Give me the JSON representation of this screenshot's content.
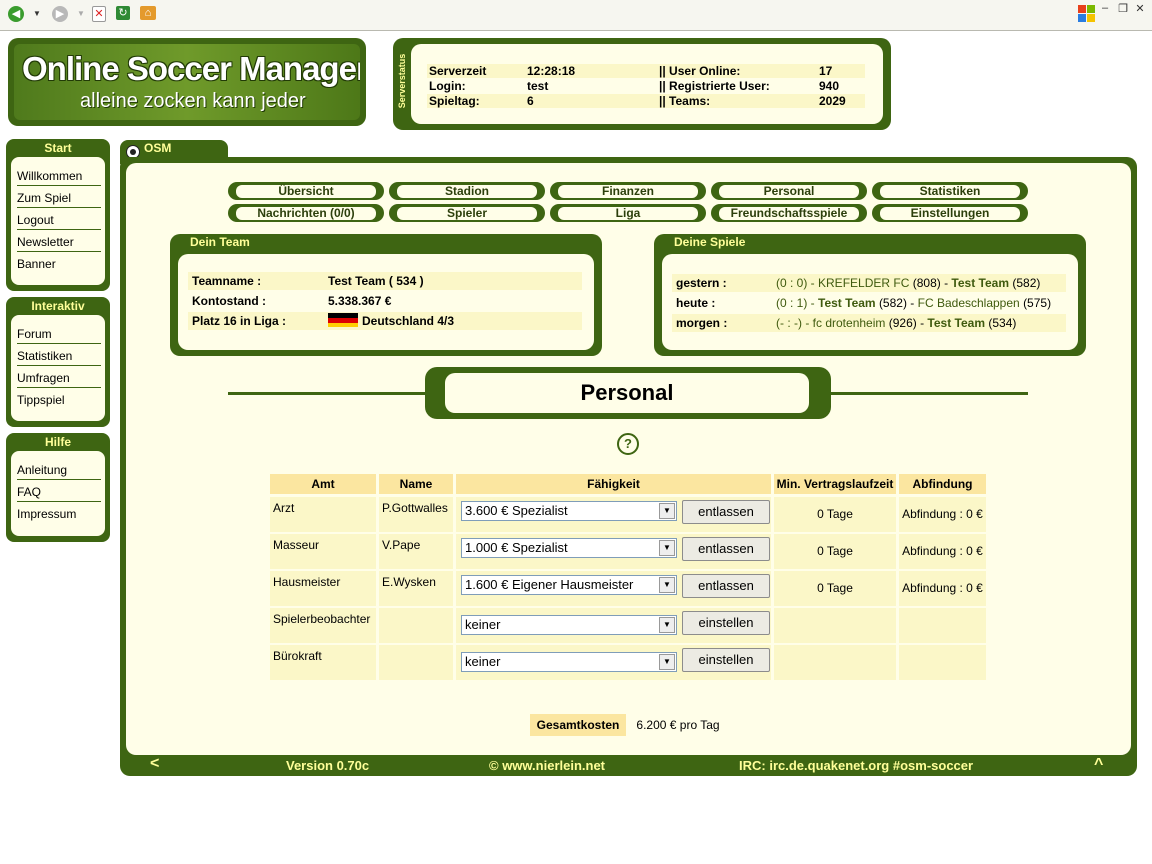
{
  "logo": {
    "title": "Online Soccer Manager",
    "subtitle": "alleine zocken kann jeder"
  },
  "server": {
    "label": "Serverstatus",
    "rows": [
      {
        "k1": "Serverzeit",
        "v1": "12:28:18",
        "k2": "|| User Online:",
        "v2": "17"
      },
      {
        "k1": "Login:",
        "v1": "test",
        "k2": "|| Registrierte User:",
        "v2": "940"
      },
      {
        "k1": "Spieltag:",
        "v1": "6",
        "k2": "|| Teams:",
        "v2": "2029"
      }
    ]
  },
  "sidebar": {
    "start": {
      "title": "Start",
      "items": [
        "Willkommen",
        "Zum Spiel",
        "Logout",
        "Newsletter",
        "Banner"
      ]
    },
    "interaktiv": {
      "title": "Interaktiv",
      "items": [
        "Forum",
        "Statistiken",
        "Umfragen",
        "Tippspiel"
      ]
    },
    "hilfe": {
      "title": "Hilfe",
      "items": [
        "Anleitung",
        "FAQ",
        "Impressum"
      ]
    }
  },
  "tab": {
    "label": "OSM"
  },
  "nav": {
    "row1": [
      "Übersicht",
      "Stadion",
      "Finanzen",
      "Personal",
      "Statistiken"
    ],
    "row2": [
      "Nachrichten (0/0)",
      "Spieler",
      "Liga",
      "Freundschaftsspiele",
      "Einstellungen"
    ]
  },
  "team": {
    "title": "Dein Team",
    "teamname_label": "Teamname :",
    "teamname": "Test Team ( 534 )",
    "konto_label": "Kontostand :",
    "konto": "5.338.367 €",
    "platz_label": "Platz 16 in Liga :",
    "liga": "Deutschland 4/3"
  },
  "spiele": {
    "title": "Deine Spiele",
    "rows": [
      {
        "day": "gestern :",
        "score": "(0 : 0) -",
        "home": "KREFELDER FC",
        "home_id": "(808)",
        "sep": "-",
        "away": "Test Team",
        "away_id": "(582)"
      },
      {
        "day": "heute :",
        "score": "(0 : 1) -",
        "home": "Test Team",
        "home_id": "(582)",
        "sep": "-",
        "away": "FC Badeschlappen",
        "away_id": "(575)"
      },
      {
        "day": "morgen :",
        "score": "(- : -) -",
        "home": "fc drotenheim",
        "home_id": "(926)",
        "sep": "-",
        "away": "Test Team",
        "away_id": "(534)"
      }
    ]
  },
  "page_heading": "Personal",
  "help_icon": "?",
  "table": {
    "headers": [
      "Amt",
      "Name",
      "Fähigkeit",
      "Min. Vertragslaufzeit",
      "Abfindung"
    ],
    "rows": [
      {
        "amt": "Arzt",
        "name": "P.Gottwalles",
        "skill": "3.600 € Spezialist",
        "button": "entlassen",
        "laufzeit": "0 Tage",
        "abfindung": "Abfindung : 0 €"
      },
      {
        "amt": "Masseur",
        "name": "V.Pape",
        "skill": "1.000 € Spezialist",
        "button": "entlassen",
        "laufzeit": "0 Tage",
        "abfindung": "Abfindung : 0 €"
      },
      {
        "amt": "Hausmeister",
        "name": "E.Wysken",
        "skill": "1.600 € Eigener Hausmeister",
        "button": "entlassen",
        "laufzeit": "0 Tage",
        "abfindung": "Abfindung : 0 €"
      },
      {
        "amt": "Spielerbeobachter",
        "name": "",
        "skill": "keiner",
        "button": "einstellen",
        "laufzeit": "",
        "abfindung": ""
      },
      {
        "amt": "Bürokraft",
        "name": "",
        "skill": "keiner",
        "button": "einstellen",
        "laufzeit": "",
        "abfindung": ""
      }
    ]
  },
  "total": {
    "label": "Gesamtkosten",
    "value": "6.200 € pro Tag"
  },
  "footer": {
    "back": "<",
    "version": "Version 0.70c",
    "copyright": "© www.nierlein.net",
    "irc": "IRC: irc.de.quakenet.org #osm-soccer",
    "top": "^"
  },
  "colors": {
    "frame": "#3e6512",
    "panel": "#fffee8",
    "highlight": "#fbf7c8",
    "header": "#fbe6a0",
    "label_yellow": "#ffff99"
  }
}
